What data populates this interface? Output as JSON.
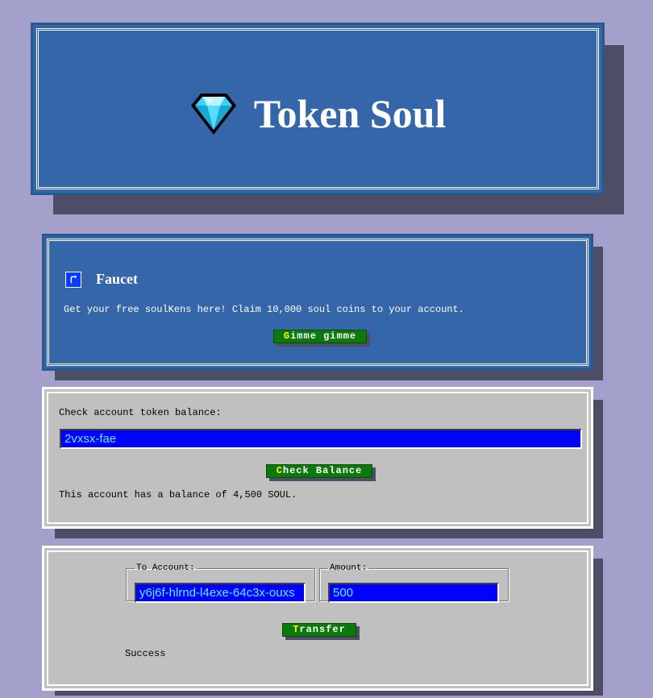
{
  "header": {
    "title": "Token Soul",
    "icon": "diamond-icon"
  },
  "faucet": {
    "heading": "Faucet",
    "icon": "faucet-icon",
    "description": "Get your free soulKens here! Claim 10,000 soul coins to your account.",
    "button_first": "G",
    "button_rest": "imme gimme"
  },
  "balance": {
    "prompt": "Check account token balance:",
    "account_value": "2vxsx-fae",
    "button_first": "C",
    "button_rest": "heck Balance",
    "result": "This account has a balance of 4,500 SOUL."
  },
  "transfer": {
    "to_label": "To Account:",
    "to_value": "y6j6f-hlrnd-l4exe-64c3x-ouxs",
    "amount_label": "Amount:",
    "amount_value": "500",
    "button_first": "T",
    "button_rest": "ransfer",
    "status": "Success"
  },
  "colors": {
    "background": "#a3a1cc",
    "panel_blue": "#3566a9",
    "panel_gray": "#c0c0c0",
    "button_green": "#0b7a0b",
    "input_blue": "#0000ff",
    "input_text": "#5cf2ff"
  }
}
